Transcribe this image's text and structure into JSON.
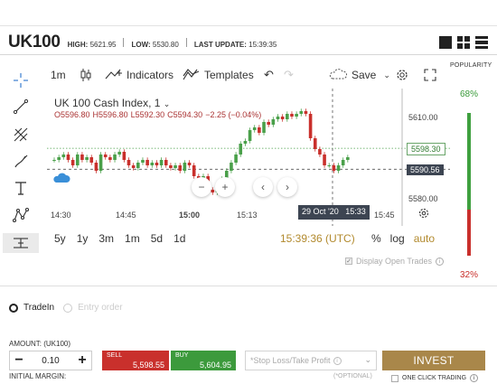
{
  "header": {
    "symbol": "UK100",
    "high_label": "HIGH:",
    "high": "5621.95",
    "low_label": "LOW:",
    "low": "5530.80",
    "update_label": "LAST UPDATE:",
    "update": "15:39:35"
  },
  "toolbar": {
    "interval": "1m",
    "indicators": "Indicators",
    "templates": "Templates",
    "save": "Save"
  },
  "chart": {
    "title": "UK 100 Cash Index, 1",
    "ohlc": {
      "o": "O5596.80",
      "h": "H5596.80",
      "l": "L5592.30",
      "c": "C5594.30",
      "chg": "−2.25 (−0.04%)"
    },
    "price_ticks": [
      "5610.00",
      "5580.00"
    ],
    "price_green": "5598.30",
    "price_dark": "5590.56",
    "time_ticks": [
      "14:30",
      "14:45",
      "15:00",
      "15:13",
      "15:45"
    ],
    "time_badge_date": "29 Oct '20",
    "time_badge_time": "15:33",
    "tick_15_00": "15:00"
  },
  "popularity": {
    "title": "POPULARITY",
    "buy_pct": "68%",
    "sell_pct": "32%",
    "buy_fraction": 0.68
  },
  "ranges": [
    "5y",
    "1y",
    "3m",
    "1m",
    "5d",
    "1d"
  ],
  "clock": "15:39:36 (UTC)",
  "scale_opts": {
    "pct": "%",
    "log": "log",
    "auto": "auto"
  },
  "display_open_trades": "Display Open Trades",
  "order": {
    "tab_tradein": "TradeIn",
    "tab_entry": "Entry order",
    "amount_label": "AMOUNT: (UK100)",
    "amount": "0.10",
    "initial_margin": "INITIAL MARGIN:",
    "sell_label": "SELL",
    "sell_price": "5,598.55",
    "buy_label": "BUY",
    "buy_price": "5,604.95",
    "sltp_placeholder": "*Stop Loss/Take Profit",
    "optional": "(*OPTIONAL)",
    "invest": "INVEST",
    "one_click": "ONE CLICK TRADING"
  },
  "colors": {
    "accent": "#b28a2e",
    "buy": "#3c9a3c",
    "sell": "#c9302c",
    "dark_badge": "#3d4552"
  }
}
